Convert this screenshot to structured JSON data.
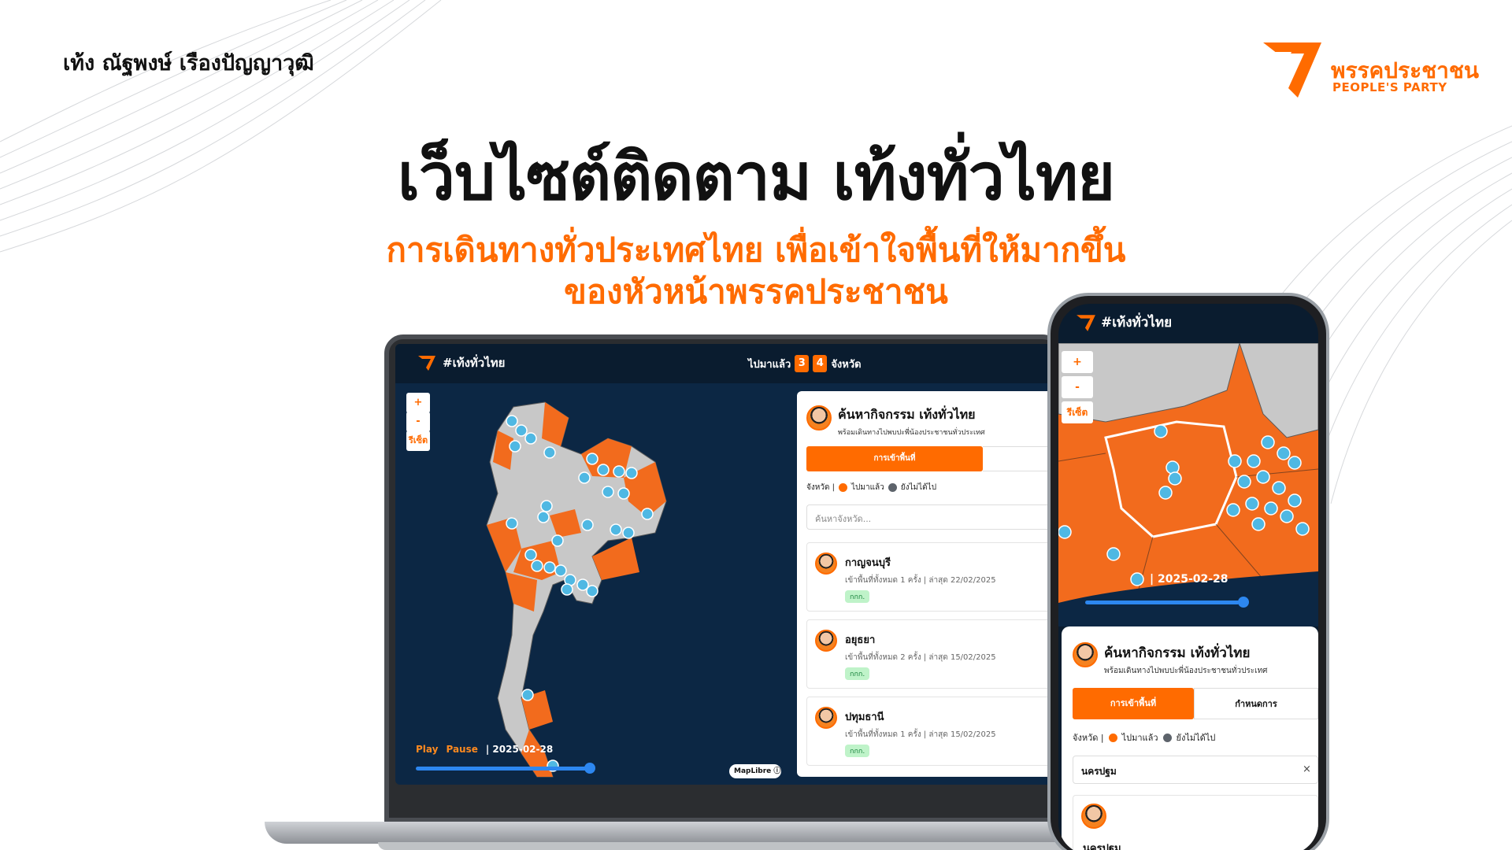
{
  "author": "เท้ง ณัฐพงษ์ เรืองปัญญาวุฒิ",
  "logo": {
    "name": "พรรคประชาชน",
    "sub": "PEOPLE'S PARTY"
  },
  "headline": "เว็บไซต์ติดตาม เท้งทั่วไทย",
  "subheadline": [
    "การเดินทางทั่วประเทศไทย เพื่อเข้าใจพื้นที่ให้มากขึ้น",
    "ของหัวหน้าพรรคประชาชน"
  ],
  "colors": {
    "accent": "#ff6b00",
    "navy": "#0a1c2f",
    "map_sea": "#0c2744",
    "visited": "#f26b1d",
    "not_visited": "#c8c8c8",
    "pin": "#4fb8e3"
  },
  "laptop": {
    "brand": "#เท้งทั่วไทย",
    "counter_label": "ไปมาแล้ว",
    "counter_digits": [
      "3",
      "4"
    ],
    "counter_unit": "จังหวัด",
    "controls": {
      "zoom_in": "+",
      "zoom_out": "-",
      "reset": "รีเซ็ต"
    },
    "play": "Play",
    "pause": "Pause",
    "date": "| 2025-02-28",
    "timeline_progress": 0.9,
    "attribution": "MapLibre",
    "panel": {
      "title": "ค้นหากิจกรรม เท้งทั่วไทย",
      "desc": "พร้อมเดินทางไปพบปะพี่น้องประชาชนทั่วประเทศ",
      "tab_active": "การเข้าพื้นที่",
      "legend_label": "จังหวัด |",
      "legend_visited": "ไปมาแล้ว",
      "legend_not": "ยังไม่ได้ไป",
      "search_placeholder": "ค้นหาจังหวัด...",
      "items": [
        {
          "name": "กาญจนบุรี",
          "meta": "เข้าพื้นที่ทั้งหมด 1 ครั้ง | ล่าสุด 22/02/2025",
          "tag": "กกก."
        },
        {
          "name": "อยุธยา",
          "meta": "เข้าพื้นที่ทั้งหมด 2 ครั้ง | ล่าสุด 15/02/2025",
          "tag": "กกก."
        },
        {
          "name": "ปทุมธานี",
          "meta": "เข้าพื้นที่ทั้งหมด 1 ครั้ง | ล่าสุด 15/02/2025",
          "tag": "กกก."
        }
      ]
    }
  },
  "phone": {
    "brand": "#เท้งทั่วไทย",
    "controls": {
      "zoom_in": "+",
      "zoom_out": "-",
      "reset": "รีเซ็ต"
    },
    "date": "| 2025-02-28",
    "timeline_progress": 0.9,
    "panel": {
      "title": "ค้นหากิจกรรม เท้งทั่วไทย",
      "desc": "พร้อมเดินทางไปพบปะพี่น้องประชาชนทั่วประเทศ",
      "tab_active": "การเข้าพื้นที่",
      "tab_2": "กำหนดการ",
      "legend_label": "จังหวัด |",
      "legend_visited": "ไปมาแล้ว",
      "legend_not": "ยังไม่ได้ไป",
      "search_value": "นครปฐม",
      "clear": "×",
      "item_name": "นครปฐม"
    }
  }
}
